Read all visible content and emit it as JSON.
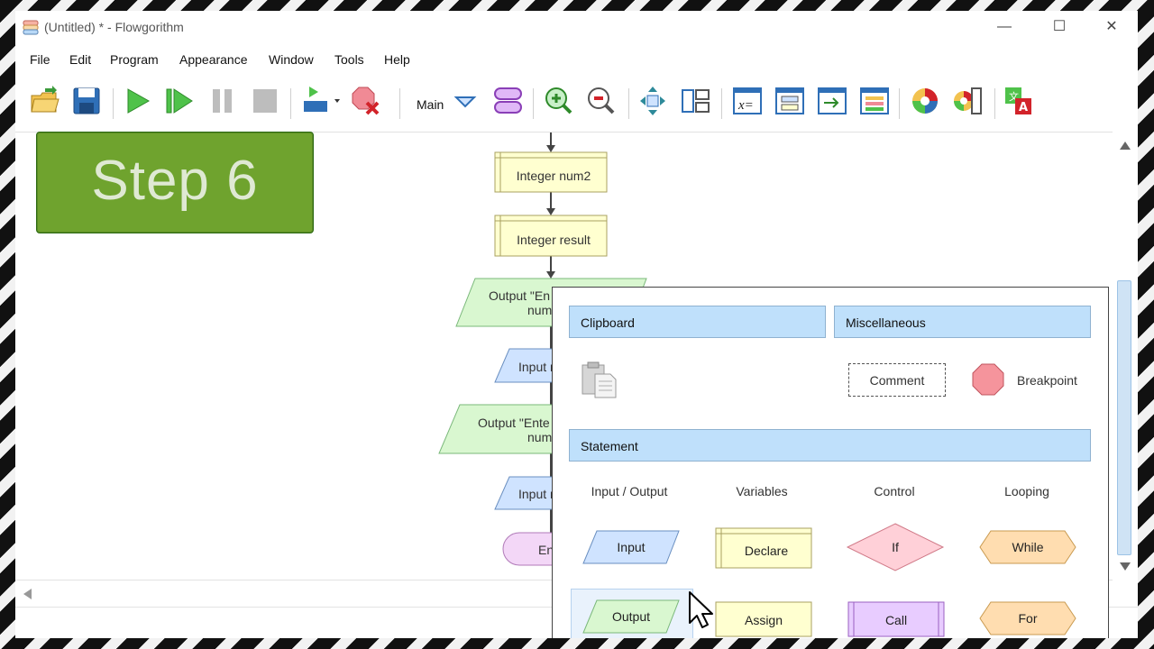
{
  "window": {
    "title": "(Untitled) * - Flowgorithm"
  },
  "menu": [
    "File",
    "Edit",
    "Program",
    "Appearance",
    "Window",
    "Tools",
    "Help"
  ],
  "toolbar": {
    "function_selector": "Main"
  },
  "overlay": {
    "step_label": "Step 6"
  },
  "flowchart": {
    "declare1": "Integer num2",
    "declare2": "Integer result",
    "output1_line1": "Output \"En",
    "output1_line2": "num",
    "input1": "Input n",
    "output2_line1": "Output \"Ente",
    "output2_line2": "num",
    "input2": "Input n",
    "end": "En"
  },
  "palette": {
    "clipboard_header": "Clipboard",
    "misc_header": "Miscellaneous",
    "comment": "Comment",
    "breakpoint": "Breakpoint",
    "statement_header": "Statement",
    "columns": [
      "Input / Output",
      "Variables",
      "Control",
      "Looping"
    ],
    "shapes": {
      "input": "Input",
      "declare": "Declare",
      "if": "If",
      "while": "While",
      "output": "Output",
      "assign": "Assign",
      "call": "Call",
      "for": "For"
    }
  },
  "colors": {
    "step_green": "#6fa32e",
    "declare_yellow": "#ffffd0",
    "input_blue": "#cfe3ff",
    "output_green": "#d9f7d0",
    "if_pink": "#ffd0d8",
    "loop_orange": "#ffddb0",
    "call_purple": "#e8ccff",
    "section_blue": "#bfe0fb"
  }
}
